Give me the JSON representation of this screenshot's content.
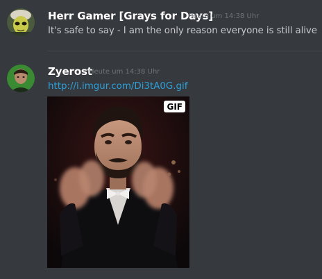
{
  "messages": [
    {
      "author": "Herr Gamer [Grays for Days]",
      "timestamp": "Heute um 14:38 Uhr",
      "text": "It's safe to say - I am the only reason everyone is still alive",
      "avatar_icon": "alien-avatar-icon"
    },
    {
      "author": "Zyerost",
      "timestamp": "Heute um 14:38 Uhr",
      "link": "http://i.imgur.com/Di3tA0G.gif",
      "avatar_icon": "person-avatar-icon",
      "embed": {
        "badge": "GIF",
        "image_icon": "clapping-man-gif-icon"
      }
    }
  ],
  "colors": {
    "background": "#36393e",
    "username": "#ffffff",
    "timestamp": "#6f7378",
    "text": "#c6c8ca",
    "link": "#2d9fd9",
    "divider": "#42454a"
  }
}
